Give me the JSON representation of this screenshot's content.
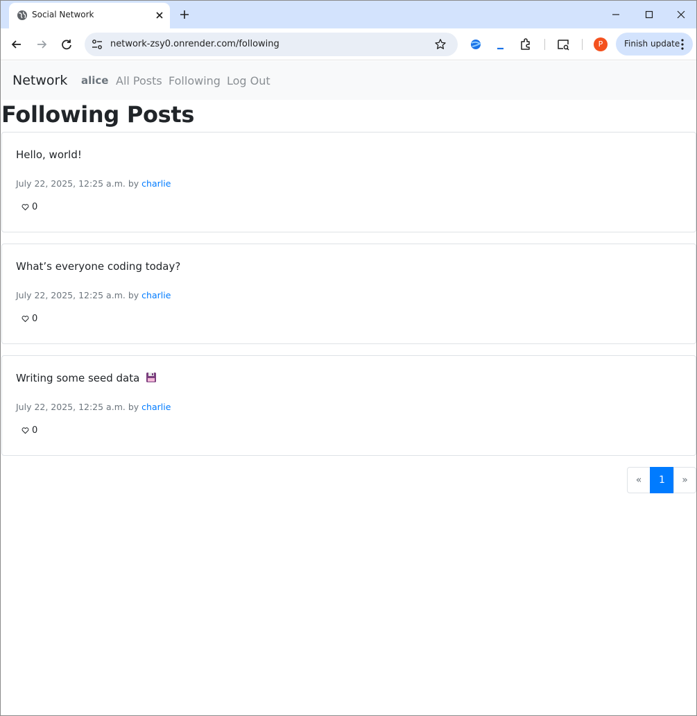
{
  "browser": {
    "tab_title": "Social Network",
    "url": "network-zsy0.onrender.com/following",
    "profile_initial": "P",
    "update_label": "Finish update"
  },
  "navbar": {
    "brand": "Network",
    "user": "alice",
    "links": [
      "All Posts",
      "Following",
      "Log Out"
    ]
  },
  "page": {
    "title": "Following Posts"
  },
  "posts": [
    {
      "content": "Hello, world!",
      "timestamp": "July 22, 2025, 12:25 a.m.",
      "by": "by",
      "author": "charlie",
      "likes": "0"
    },
    {
      "content": "What’s everyone coding today?",
      "timestamp": "July 22, 2025, 12:25 a.m.",
      "by": "by",
      "author": "charlie",
      "likes": "0"
    },
    {
      "content": "Writing some seed data",
      "timestamp": "July 22, 2025, 12:25 a.m.",
      "by": "by",
      "author": "charlie",
      "likes": "0"
    }
  ],
  "pagination": {
    "prev": "«",
    "current": "1",
    "next": "»"
  },
  "colors": {
    "accent": "#007bff",
    "tab_strip": "#d3e3fd",
    "navbar_bg": "#f8f9fa"
  }
}
